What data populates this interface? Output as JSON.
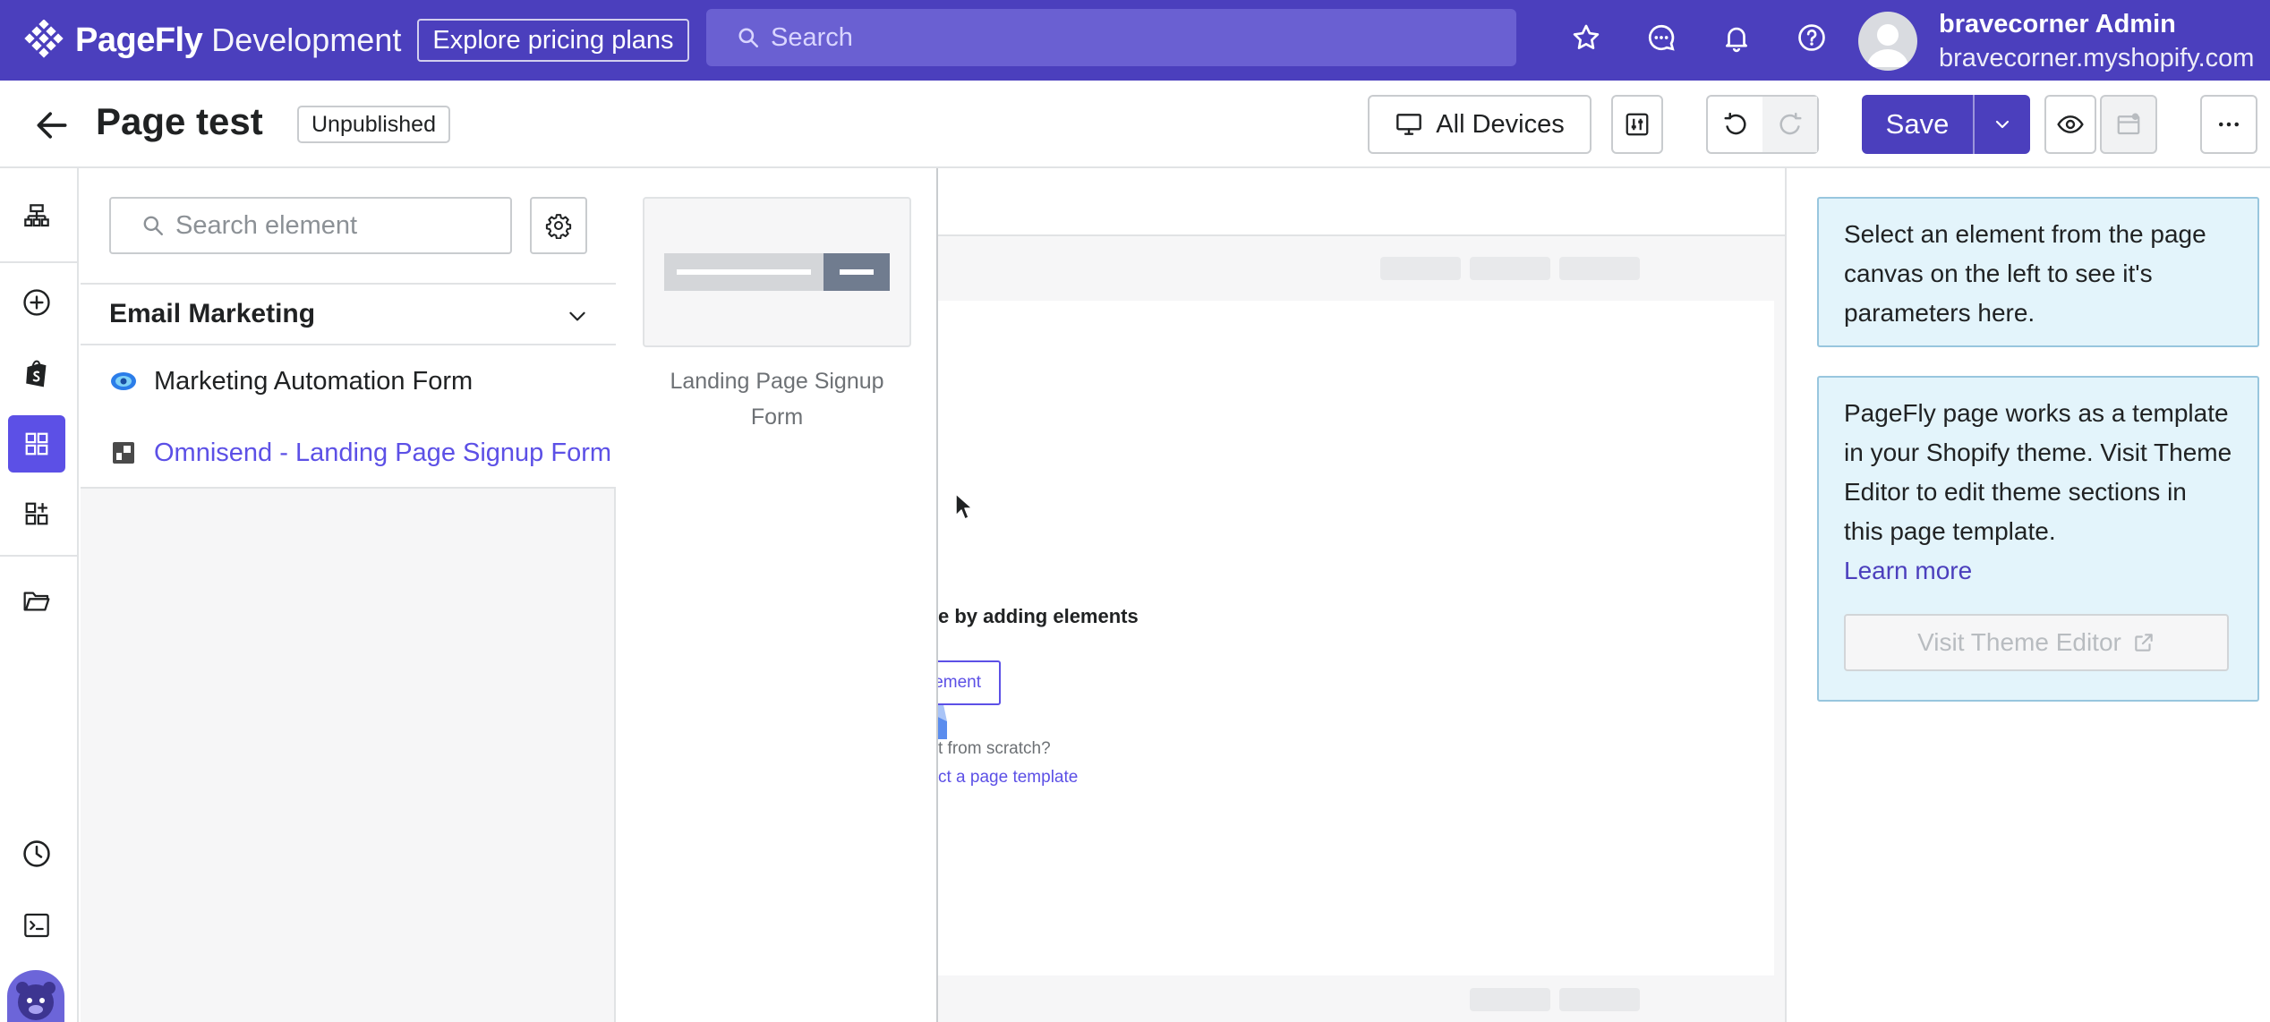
{
  "topbar": {
    "brand_name": "PageFly",
    "brand_env": "Development",
    "pricing_label": "Explore pricing plans",
    "search_placeholder": "Search",
    "user_name": "bravecorner Admin",
    "user_store": "bravecorner.myshopify.com",
    "icons": [
      "star-icon",
      "chat-icon",
      "bell-icon",
      "help-icon"
    ],
    "bg_color": "#4b3fbd"
  },
  "header": {
    "page_title": "Page test",
    "status": "Unpublished",
    "devices_label": "All Devices",
    "save_label": "Save"
  },
  "rail": {
    "icons": [
      "layers-icon",
      "add-icon",
      "shopify-icon",
      "elements-icon",
      "add-section-icon",
      "folder-icon",
      "history-icon",
      "code-icon",
      "avatar-icon"
    ],
    "active": "elements-icon"
  },
  "element_panel": {
    "search_placeholder": "Search element",
    "category": "Email Marketing",
    "items": [
      {
        "label": "Marketing Automation Form",
        "selected": false
      },
      {
        "label": "Omnisend - Landing Page Signup Form",
        "selected": true
      }
    ],
    "accent": "#5c50e6"
  },
  "variants": {
    "caption": "Landing Page Signup Form"
  },
  "canvas": {
    "empty_title": "e by adding elements",
    "add_button": "lement",
    "scratch_text": "t from scratch?",
    "template_link": "ct a page template"
  },
  "inspector": {
    "hint": "Select an element from the page canvas on the left to see it's parameters here.",
    "theme_info": "PageFly page works as a template in your Shopify theme. Visit Theme Editor to edit theme sections in this page template.",
    "learn_more": "Learn more",
    "theme_button": "Visit Theme Editor",
    "info_bg": "#e3f4fb"
  }
}
